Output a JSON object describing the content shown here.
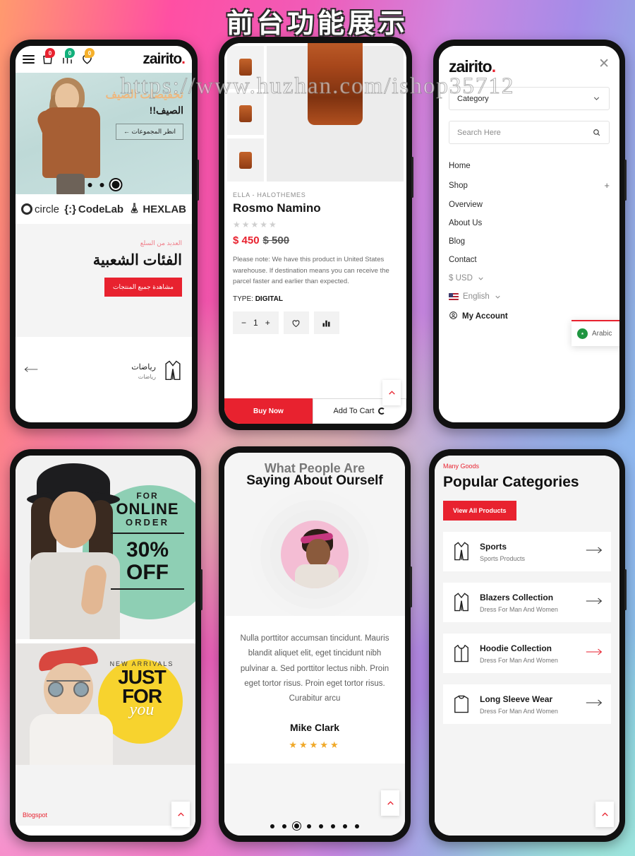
{
  "page": {
    "title": "前台功能展示",
    "watermark": "https://www.huzhan.com/ishop35712"
  },
  "colors": {
    "accent_red": "#e8222f",
    "badge_green": "#11b07b",
    "badge_yellow": "#f5b02a",
    "star_orange": "#f0a929"
  },
  "phone1": {
    "header": {
      "menu_icon": "hamburger-icon",
      "cart_count": "0",
      "compare_count": "0",
      "wishlist_count": "0",
      "logo": "zairito"
    },
    "hero": {
      "line1": "تخفيضات الصيف",
      "line2": "الصيف!!",
      "button": "انظر المجموعات  ←",
      "dots": 3,
      "active_dot": 3
    },
    "brands": [
      {
        "name": "circle",
        "icon": "ring-icon"
      },
      {
        "name": "CodeLab",
        "prefix": "{:}"
      },
      {
        "name": "HEXLAB",
        "icon": "flask-icon"
      }
    ],
    "categories": {
      "subtitle": "العديد من السلع",
      "title": "الفئات الشعبية",
      "button": "مشاهدة جميع المنتجات",
      "item": {
        "title": "رياضات",
        "subtitle": "رياضات"
      }
    }
  },
  "phone2": {
    "brand": "ELLA - HALOTHEMES",
    "title": "Rosmo Namino",
    "stars": "★★★★★",
    "price": "$ 450",
    "old_price": "$ 500",
    "description": "Please note: We have this product in United States warehouse. If destination means you can receive the parcel faster and earlier than expected.",
    "type_label": "TYPE:",
    "type_value": "DIGITAL",
    "qty": "1",
    "minus": "−",
    "plus": "+",
    "wishlist_icon": "heart-icon",
    "compare_icon": "compare-bars-icon",
    "buy_now": "Buy Now",
    "add_to_cart": "Add To Cart"
  },
  "phone3": {
    "logo": "zairito",
    "close_icon": "close-icon",
    "category_select": "Category",
    "search_placeholder": "Search Here",
    "nav": [
      {
        "label": "Home",
        "expand": ""
      },
      {
        "label": "Shop",
        "expand": "+"
      },
      {
        "label": "Overview",
        "expand": ""
      },
      {
        "label": "About Us",
        "expand": ""
      },
      {
        "label": "Blog",
        "expand": ""
      },
      {
        "label": "Contact",
        "expand": ""
      }
    ],
    "currency": "$ USD",
    "language": "English",
    "account": "My Account",
    "lang_popup": "Arabic"
  },
  "phone4": {
    "banner1": {
      "for": "FOR",
      "online": "ONLINE",
      "order": "ORDER",
      "percent": "30%",
      "off": "OFF"
    },
    "banner2": {
      "kicker": "NEW ARRIVALS",
      "just": "JUST",
      "forline": "FOR",
      "you": "you"
    },
    "footer_label": "Blogspot"
  },
  "phone5": {
    "heading_line1": "What People Are",
    "heading_line2": "Saying About Ourself",
    "quote": "Nulla porttitor accumsan tincidunt. Mauris blandit aliquet elit, eget tincidunt nibh pulvinar a. Sed porttitor lectus nibh. Proin eget tortor risus. Proin eget tortor risus. Curabitur arcu",
    "author": "Mike Clark",
    "stars": "★★★★★",
    "dots": 8,
    "active_dot": 3
  },
  "phone6": {
    "subtitle": "Many Goods",
    "title": "Popular Categories",
    "button": "View All Products",
    "rows": [
      {
        "title": "Sports",
        "subtitle": "Sports Products",
        "icon": "blazer-icon",
        "arrow_active": false
      },
      {
        "title": "Blazers Collection",
        "subtitle": "Dress For Man And Women",
        "icon": "blazer-icon",
        "arrow_active": false
      },
      {
        "title": "Hoodie Collection",
        "subtitle": "Dress For Man And Women",
        "icon": "hoodie-icon",
        "arrow_active": true
      },
      {
        "title": "Long Sleeve Wear",
        "subtitle": "Dress For Man And Women",
        "icon": "longsleeve-icon",
        "arrow_active": false
      }
    ]
  }
}
